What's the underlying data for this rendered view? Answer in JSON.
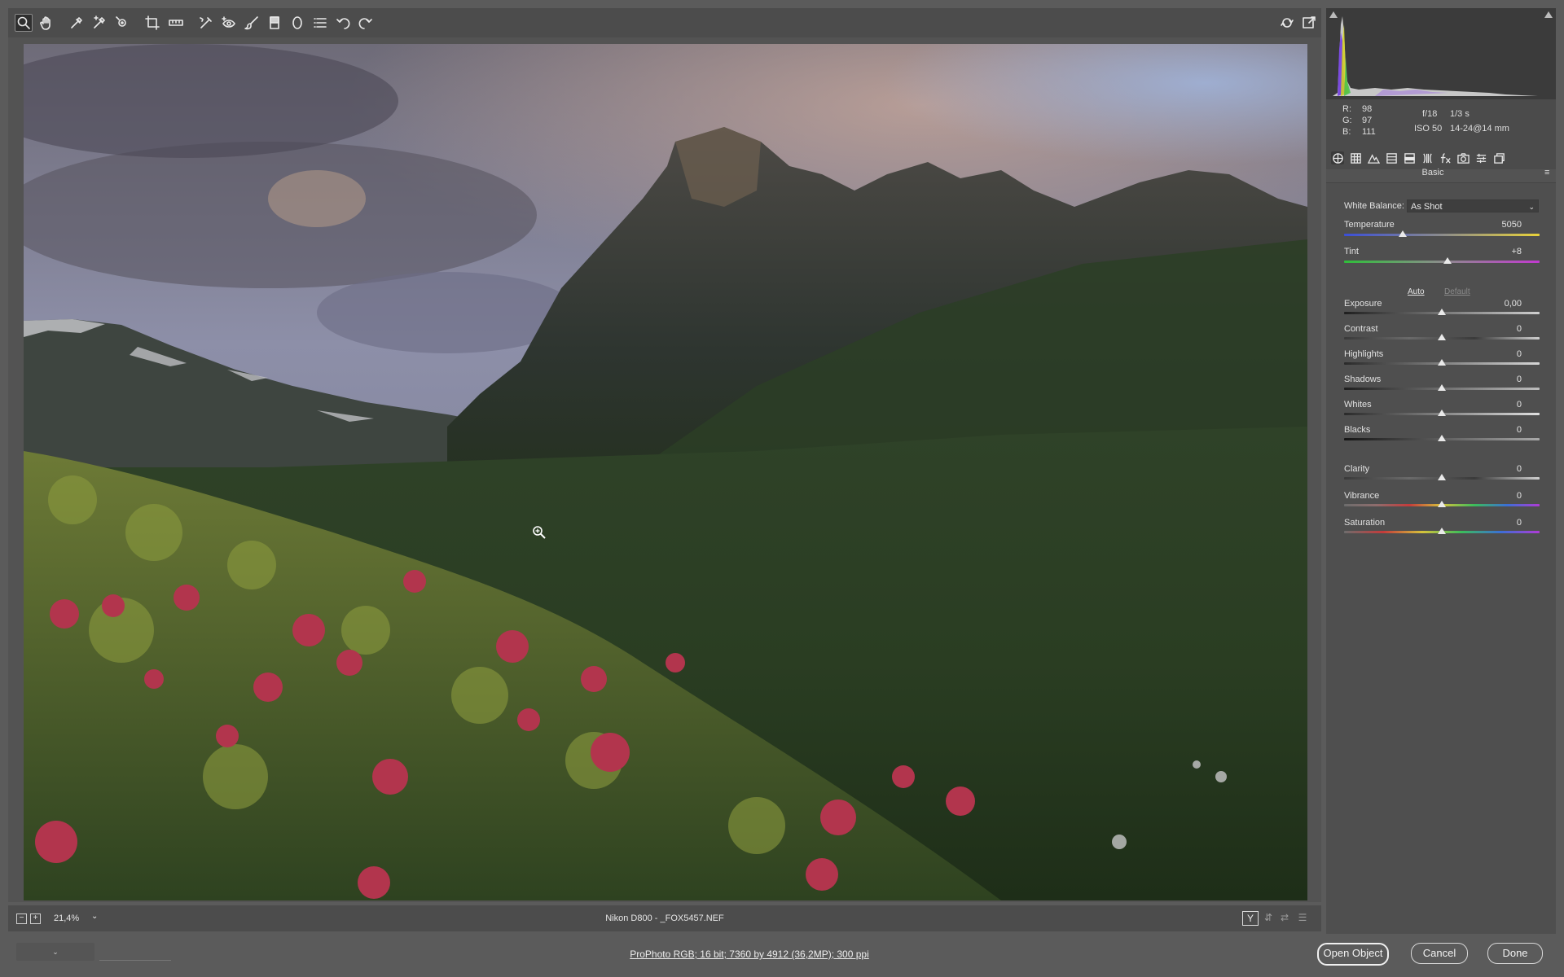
{
  "toolbar": {
    "tools": [
      {
        "name": "zoom-tool",
        "icon": "magnifier-icon",
        "active": true
      },
      {
        "name": "hand-tool",
        "icon": "hand-icon"
      },
      {
        "name": "white-balance-tool",
        "icon": "eyedropper-icon"
      },
      {
        "name": "color-sampler-tool",
        "icon": "eyedropper-plus-icon"
      },
      {
        "name": "targeted-adjustment-tool",
        "icon": "target-icon"
      },
      {
        "name": "crop-tool",
        "icon": "crop-icon"
      },
      {
        "name": "straighten-tool",
        "icon": "ruler-icon"
      },
      {
        "name": "spot-removal-tool",
        "icon": "spot-removal-icon"
      },
      {
        "name": "red-eye-tool",
        "icon": "red-eye-icon"
      },
      {
        "name": "adjustment-brush-tool",
        "icon": "brush-icon"
      },
      {
        "name": "graduated-filter-tool",
        "icon": "graduated-filter-icon"
      },
      {
        "name": "radial-filter-tool",
        "icon": "radial-filter-icon"
      },
      {
        "name": "preferences-button",
        "icon": "list-icon"
      },
      {
        "name": "rotate-left-button",
        "icon": "rotate-ccw-icon"
      },
      {
        "name": "rotate-right-button",
        "icon": "rotate-cw-icon"
      }
    ],
    "right_icons": [
      "preview-toggle-icon",
      "fullscreen-icon"
    ]
  },
  "status": {
    "zoom": "21,4%",
    "file": "Nikon D800  -  _FOX5457.NEF",
    "zoom_out_glyph": "−",
    "zoom_in_glyph": "+",
    "dropdown_glyph": "⌄",
    "view_glyph": "Y"
  },
  "bottom": {
    "workflow": "ProPhoto RGB; 16 bit; 7360 by 4912 (36,2MP); 300 ppi",
    "left_dropdown_glyph": "⌄",
    "open_label": "Open Object",
    "cancel_label": "Cancel",
    "done_label": "Done"
  },
  "readout": {
    "r_label": "R:",
    "r": "98",
    "g_label": "G:",
    "g": "97",
    "b_label": "B:",
    "b": "111",
    "aperture": "f/18",
    "shutter": "1/3 s",
    "iso": "ISO 50",
    "lens": "14-24@14 mm"
  },
  "panel": {
    "title": "Basic",
    "menu_glyph": "≡",
    "tabs": [
      "basic-icon",
      "tone-curve-icon",
      "detail-icon",
      "hsl-icon",
      "split-toning-icon",
      "lens-corrections-icon",
      "effects-icon",
      "camera-calibration-icon",
      "presets-icon",
      "snapshots-icon"
    ],
    "white_balance_label": "White Balance:",
    "white_balance_value": "As Shot",
    "auto_label": "Auto",
    "default_label": "Default",
    "sliders": {
      "temperature": {
        "label": "Temperature",
        "value": "5050",
        "fraction": 0.3
      },
      "tint": {
        "label": "Tint",
        "value": "+8",
        "fraction": 0.53
      },
      "exposure": {
        "label": "Exposure",
        "value": "0,00",
        "fraction": 0.5
      },
      "contrast": {
        "label": "Contrast",
        "value": "0",
        "fraction": 0.5
      },
      "highlights": {
        "label": "Highlights",
        "value": "0",
        "fraction": 0.5
      },
      "shadows": {
        "label": "Shadows",
        "value": "0",
        "fraction": 0.5
      },
      "whites": {
        "label": "Whites",
        "value": "0",
        "fraction": 0.5
      },
      "blacks": {
        "label": "Blacks",
        "value": "0",
        "fraction": 0.5
      },
      "clarity": {
        "label": "Clarity",
        "value": "0",
        "fraction": 0.5
      },
      "vibrance": {
        "label": "Vibrance",
        "value": "0",
        "fraction": 0.5
      },
      "saturation": {
        "label": "Saturation",
        "value": "0",
        "fraction": 0.5
      }
    }
  },
  "colors": {
    "accent_thumb": "#e9e9e9",
    "temperature_gradient": [
      "#3b4fd8",
      "#e8d23a"
    ],
    "tint_gradient": [
      "#2fbf3a",
      "#c23ad0"
    ]
  }
}
